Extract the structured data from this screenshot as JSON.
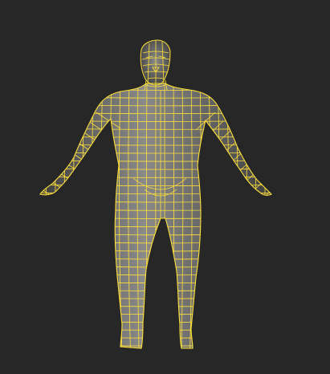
{
  "viewport": {
    "background_color": "#272727",
    "mesh_fill_color": "#8a8a8a",
    "mesh_shade_color": "#3e3e3e",
    "wireframe_color": "#ffe13a",
    "selection_state": "selected"
  },
  "model": {
    "kind": "humanoid-base-mesh",
    "pose": "a-pose",
    "display_mode": "smooth-shaded-with-edged-faces"
  }
}
